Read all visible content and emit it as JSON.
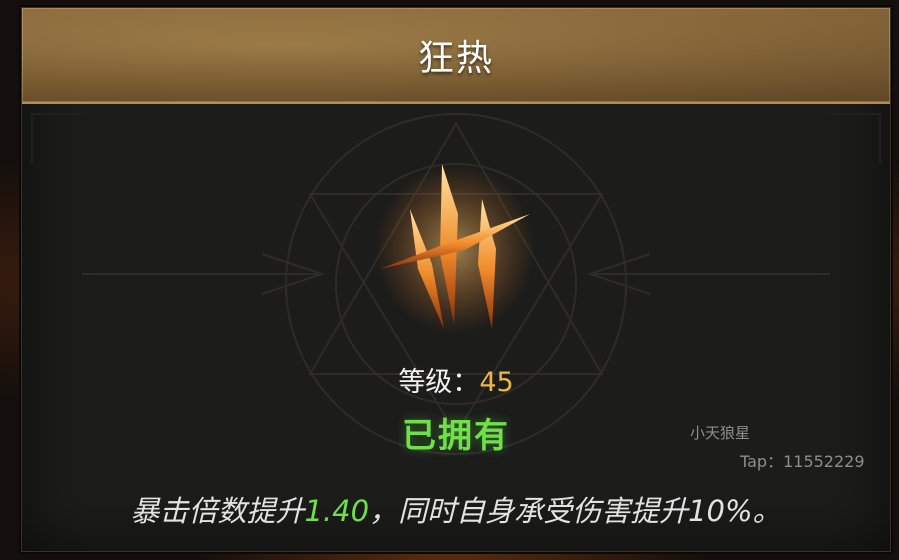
{
  "title": "狂热",
  "level": {
    "label": "等级：",
    "value": "45"
  },
  "status": "已拥有",
  "description": {
    "prefix": "暴击倍数提升",
    "value": "1.40",
    "suffix": "，同时自身承受伤害提升10%。"
  },
  "watermark": {
    "name": "小天狼星",
    "tap": "Tap：11552229"
  },
  "colors": {
    "header": "#8b6a3b",
    "panel": "#1c1c1b",
    "level_value": "#eeb54a",
    "status": "#6ee04a",
    "highlight": "#6ee04a"
  },
  "icon": "triple-claw-slash-icon"
}
